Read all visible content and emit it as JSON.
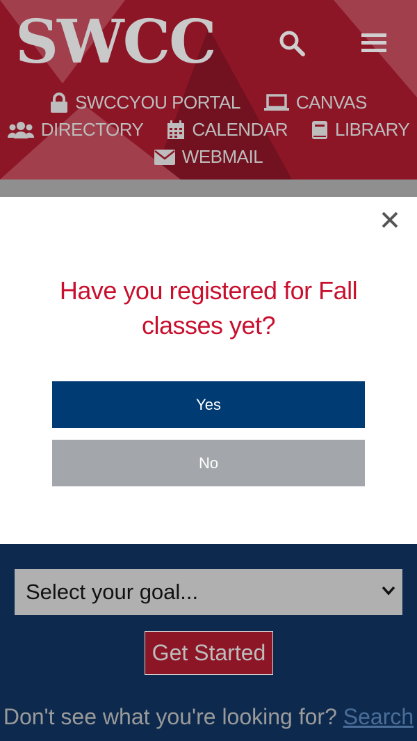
{
  "header": {
    "logo_text": "SWCC",
    "search_icon": "search-icon",
    "menu_icon": "hamburger-menu-icon",
    "links": [
      {
        "label": "SWCCYOU PORTAL",
        "icon": "lock-icon"
      },
      {
        "label": "CANVAS",
        "icon": "laptop-icon"
      },
      {
        "label": "DIRECTORY",
        "icon": "users-icon"
      },
      {
        "label": "CALENDAR",
        "icon": "calendar-icon"
      },
      {
        "label": "LIBRARY",
        "icon": "book-icon"
      },
      {
        "label": "WEBMAIL",
        "icon": "envelope-icon"
      }
    ]
  },
  "modal": {
    "question": "Have you registered for Fall classes yet?",
    "yes_label": "Yes",
    "no_label": "No",
    "close_icon": "close-icon"
  },
  "main": {
    "goal_select_value": "Select your goal...",
    "get_started_label": "Get Started",
    "footer_text": "Don't see what you're looking for?",
    "footer_link": "Search"
  },
  "colors": {
    "header_bg": "#8c1526",
    "question_red": "#c8102e",
    "yes_blue": "#003b73",
    "no_gray": "#a3a6aa",
    "main_bg": "#0d2a4e"
  }
}
